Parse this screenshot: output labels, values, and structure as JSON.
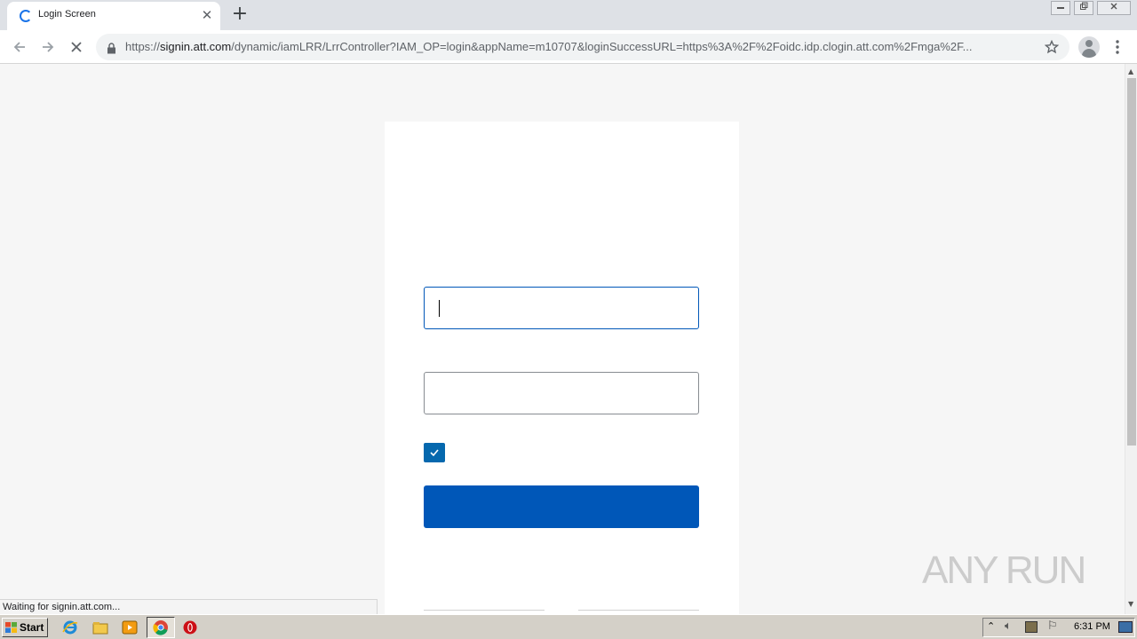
{
  "browser": {
    "tab_title": "Login Screen",
    "tab_close": "✕",
    "new_tab": "+",
    "url_scheme": "https://",
    "url_host": "signin.att.com",
    "url_path": "/dynamic/iamLRR/LrrController?IAM_OP=login&appName=m10707&loginSuccessURL=https%3A%2F%2Foidc.idp.clogin.att.com%2Fmga%2F...",
    "status_text": "Waiting for signin.att.com...",
    "icons": [
      "back-arrow-icon",
      "forward-arrow-icon",
      "stop-icon",
      "lock-icon",
      "star-icon",
      "profile-icon",
      "kebab-menu-icon"
    ]
  },
  "page": {
    "username_value": "",
    "password_value": "",
    "remember_checked": true,
    "accent_color": "#0057b8"
  },
  "watermark": {
    "text": "ANY RUN"
  },
  "taskbar": {
    "start_label": "Start",
    "clock": "6:31 PM",
    "pinned": [
      "internet-explorer-icon",
      "file-explorer-icon",
      "media-player-icon",
      "chrome-icon",
      "opera-icon"
    ]
  }
}
